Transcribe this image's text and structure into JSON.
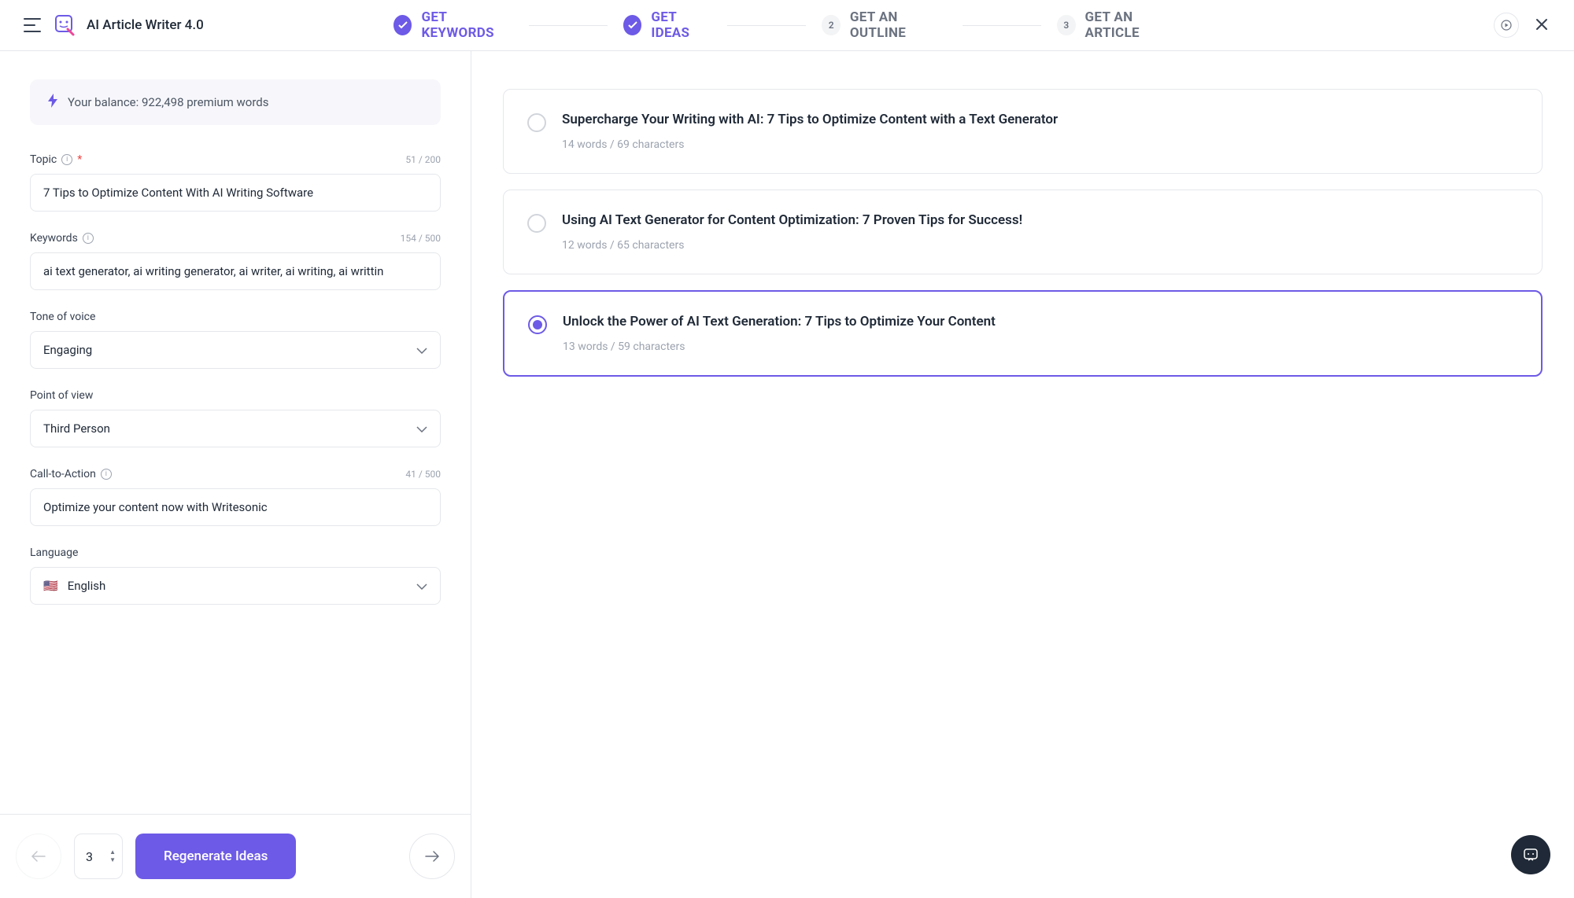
{
  "header": {
    "app_title": "AI Article Writer 4.0",
    "steps": [
      {
        "label": "GET KEYWORDS",
        "status": "done"
      },
      {
        "label": "GET IDEAS",
        "status": "done"
      },
      {
        "label": "GET AN OUTLINE",
        "status": "pending",
        "num": "2"
      },
      {
        "label": "GET AN ARTICLE",
        "status": "pending",
        "num": "3"
      }
    ]
  },
  "sidebar": {
    "balance_text": "Your balance: 922,498 premium words",
    "topic": {
      "label": "Topic",
      "count": "51 / 200",
      "value": "7 Tips to Optimize Content With AI Writing Software"
    },
    "keywords": {
      "label": "Keywords",
      "count": "154 / 500",
      "value": "ai text generator, ai writing generator, ai writer, ai writing, ai writtin"
    },
    "tone": {
      "label": "Tone of voice",
      "value": "Engaging"
    },
    "pov": {
      "label": "Point of view",
      "value": "Third Person"
    },
    "cta": {
      "label": "Call-to-Action",
      "count": "41 / 500",
      "value": "Optimize your content now with Writesonic"
    },
    "language": {
      "label": "Language",
      "value": "English"
    },
    "footer": {
      "stepper_value": "3",
      "regenerate_label": "Regenerate Ideas"
    }
  },
  "ideas": [
    {
      "title": "Supercharge Your Writing with AI: 7 Tips to Optimize Content with a Text Generator",
      "meta": "14 words / 69 characters",
      "selected": false
    },
    {
      "title": "Using AI Text Generator for Content Optimization: 7 Proven Tips for Success!",
      "meta": "12 words / 65 characters",
      "selected": false
    },
    {
      "title": "Unlock the Power of AI Text Generation: 7 Tips to Optimize Your Content",
      "meta": "13 words / 59 characters",
      "selected": true
    }
  ]
}
